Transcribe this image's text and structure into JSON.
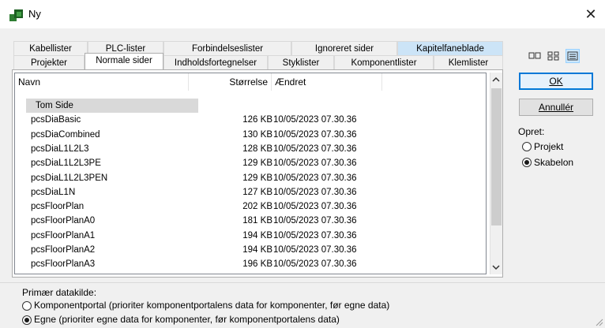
{
  "window": {
    "title": "Ny",
    "close_glyph": "✕"
  },
  "tabs_back": [
    "Kabellister",
    "PLC-lister",
    "Forbindelseslister",
    "Ignoreret sider",
    "Kapitelfaneblade"
  ],
  "tabs_front": [
    "Projekter",
    "Normale sider",
    "Indholdsfortegnelser",
    "Styklister",
    "Komponentlister",
    "Klemlister"
  ],
  "active_tab": "Normale sider",
  "list": {
    "columns": [
      "Navn",
      "Størrelse",
      "Ændret"
    ],
    "rows": [
      {
        "name": "Tom Side",
        "size": "",
        "date": ""
      },
      {
        "name": "pcsDiaBasic",
        "size": "126 KB",
        "date": "10/05/2023 07.30.36"
      },
      {
        "name": "pcsDiaCombined",
        "size": "130 KB",
        "date": "10/05/2023 07.30.36"
      },
      {
        "name": "pcsDiaL1L2L3",
        "size": "128 KB",
        "date": "10/05/2023 07.30.36"
      },
      {
        "name": "pcsDiaL1L2L3PE",
        "size": "129 KB",
        "date": "10/05/2023 07.30.36"
      },
      {
        "name": "pcsDiaL1L2L3PEN",
        "size": "129 KB",
        "date": "10/05/2023 07.30.36"
      },
      {
        "name": "pcsDiaL1N",
        "size": "127 KB",
        "date": "10/05/2023 07.30.36"
      },
      {
        "name": "pcsFloorPlan",
        "size": "202 KB",
        "date": "10/05/2023 07.30.36"
      },
      {
        "name": "pcsFloorPlanA0",
        "size": "181 KB",
        "date": "10/05/2023 07.30.36"
      },
      {
        "name": "pcsFloorPlanA1",
        "size": "194 KB",
        "date": "10/05/2023 07.30.36"
      },
      {
        "name": "pcsFloorPlanA2",
        "size": "194 KB",
        "date": "10/05/2023 07.30.36"
      },
      {
        "name": "pcsFloorPlanA3",
        "size": "196 KB",
        "date": "10/05/2023 07.30.36"
      }
    ]
  },
  "buttons": {
    "ok": "OK",
    "cancel": "Annullér"
  },
  "create_group": {
    "label": "Opret:",
    "options": [
      "Projekt",
      "Skabelon"
    ],
    "selected": "Skabelon"
  },
  "data_source": {
    "label": "Primær datakilde:",
    "options": [
      "Komponentportal (prioriter komponentportalens data for komponenter, før egne data)",
      "Egne (prioriter egne data for komponenter, før komponentportalens data)"
    ],
    "selected": 1
  },
  "colors": {
    "accent": "#0078d7",
    "selected_row": "#d9d9d9",
    "tab_highlight": "#cce4f7"
  }
}
